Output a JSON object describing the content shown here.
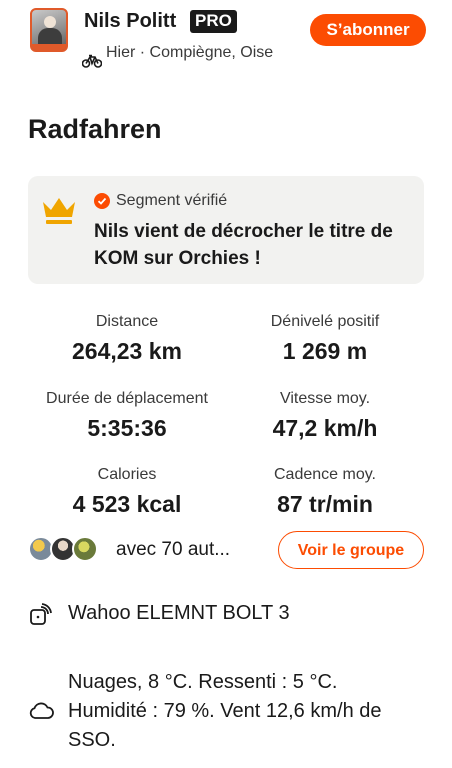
{
  "athlete": {
    "name": "Nils Politt",
    "badge": "PRO",
    "meta": "Hier · Compiègne, Oise",
    "activity_icon": "bike-icon"
  },
  "subscribe_label": "S’abonner",
  "activity_title": "Radfahren",
  "segment": {
    "label": "Segment vérifié",
    "text": "Nils vient de décrocher le titre de KOM sur Orchies !",
    "icon": "crown-icon",
    "accent": "#f0a500"
  },
  "stats": [
    {
      "label": "Distance",
      "value": "264,23 km"
    },
    {
      "label": "Dénivelé positif",
      "value": "1 269 m"
    },
    {
      "label": "Durée de déplacement",
      "value": "5:35:36"
    },
    {
      "label": "Vitesse moy.",
      "value": "47,2 km/h"
    },
    {
      "label": "Calories",
      "value": "4 523 kcal"
    },
    {
      "label": "Cadence moy.",
      "value": "87 tr/min"
    }
  ],
  "group": {
    "others_text": "avec 70 aut...",
    "button_label": "Voir le groupe"
  },
  "device": {
    "name": "Wahoo ELEMNT BOLT 3",
    "icon": "watch-icon"
  },
  "weather": {
    "text": "Nuages, 8  °C. Ressenti : 5  °C. Humidité : 79 %. Vent 12,6 km/h de SSO.",
    "icon": "cloud-icon"
  },
  "colors": {
    "brand": "#fc4c02",
    "text": "#1a1a1a",
    "card": "#f2f2f0"
  }
}
